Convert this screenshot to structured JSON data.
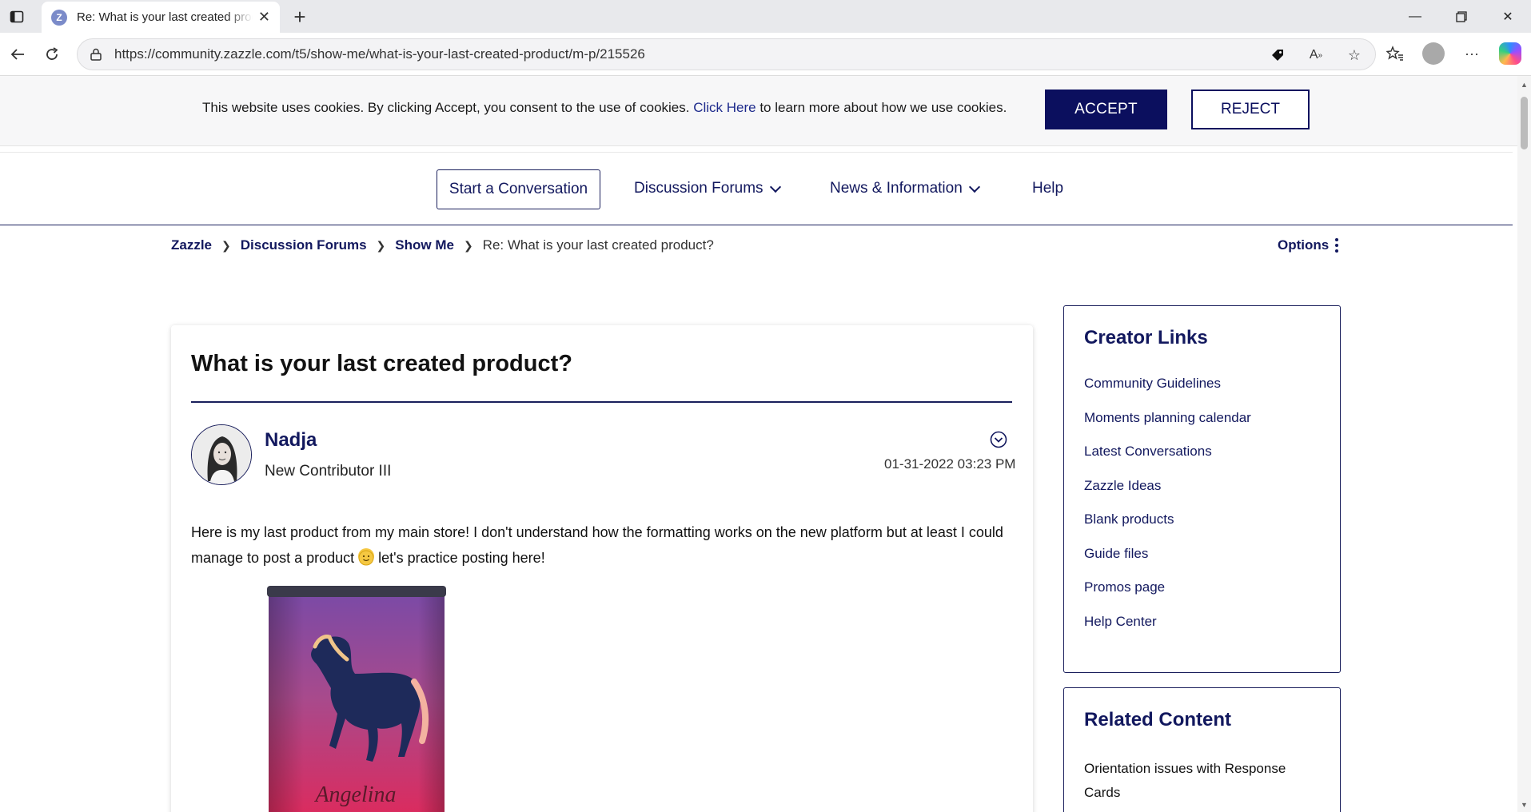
{
  "browser": {
    "tab_title": "Re: What is your last created product?",
    "favicon_letter": "Z",
    "url": "https://community.zazzle.com/t5/show-me/what-is-your-last-created-product/m-p/215526"
  },
  "cookie_banner": {
    "text_before": "This website uses cookies. By clicking Accept, you consent to the use of cookies. ",
    "link_text": "Click Here",
    "text_after": " to learn more about how we use cookies.",
    "accept_label": "ACCEPT",
    "reject_label": "REJECT"
  },
  "site_nav": {
    "start_conversation": "Start a Conversation",
    "discussion_forums": "Discussion Forums",
    "news_information": "News & Information",
    "help": "Help"
  },
  "breadcrumb": {
    "items": [
      "Zazzle",
      "Discussion Forums",
      "Show Me"
    ],
    "current": "Re: What is your last created product?"
  },
  "options_label": "Options",
  "post": {
    "title": "What is your last created product?",
    "author": "Nadja",
    "rank": "New Contributor III",
    "date": "01-31-2022 03:23 PM",
    "body_part1": "Here is my last product from my main store! I don't understand how the formatting works on the new platform but at least I could manage to post a product ",
    "body_part2": " let's practice posting here!",
    "product_text": "Angelina"
  },
  "sidebar": {
    "creator_links_title": "Creator Links",
    "creator_links": [
      "Community Guidelines",
      "Moments planning calendar",
      "Latest Conversations",
      "Zazzle Ideas",
      "Blank products",
      "Guide files",
      "Promos page",
      "Help Center"
    ],
    "related_title": "Related Content",
    "related_item": "Orientation issues with Response Cards"
  },
  "colors": {
    "brand_navy": "#12185e",
    "accept_bg": "#0b0f5e"
  }
}
